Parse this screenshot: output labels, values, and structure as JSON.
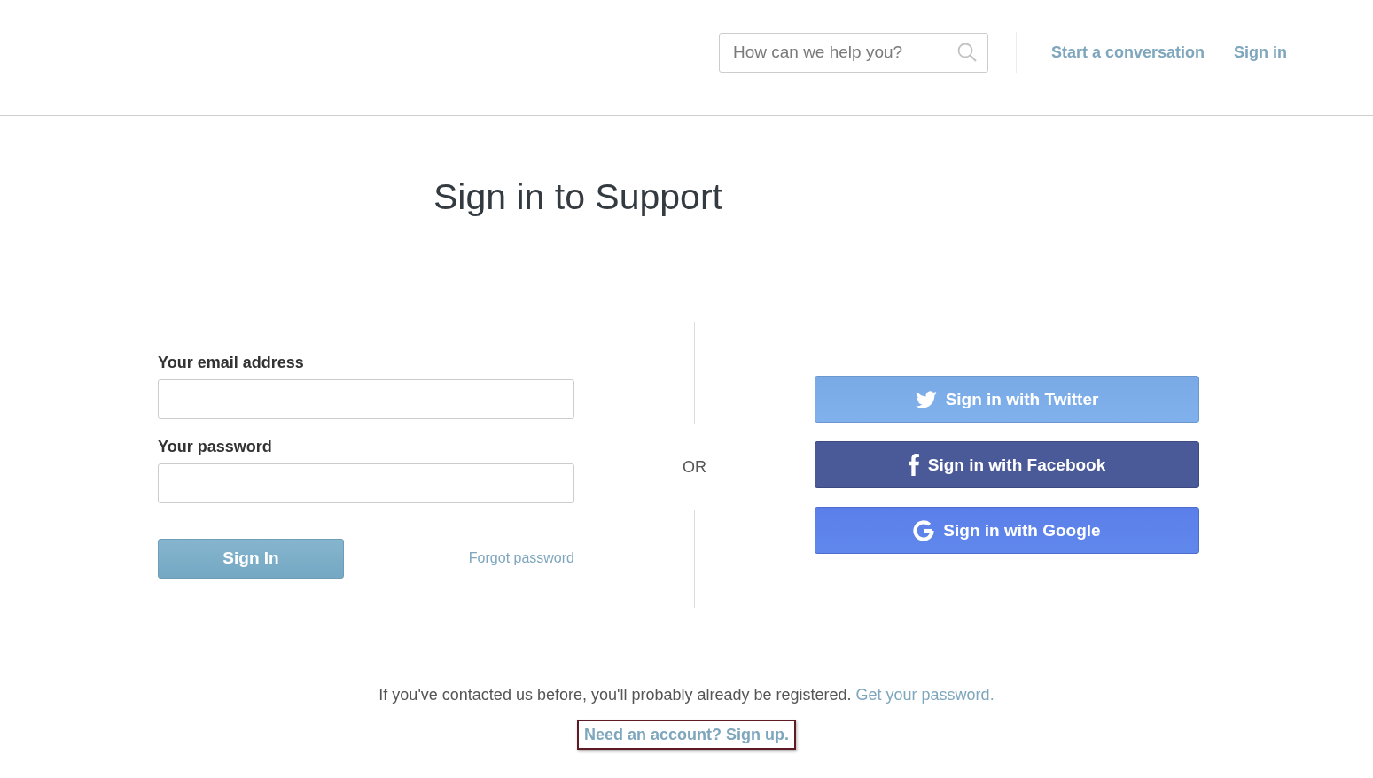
{
  "header": {
    "search": {
      "placeholder": "How can we help you?"
    },
    "nav_links": [
      "Start a conversation",
      "Sign in"
    ]
  },
  "title": "Sign in to Support",
  "form": {
    "fields": [
      {
        "label": "Your email address"
      },
      {
        "label": "Your password"
      }
    ],
    "submit_button": "Sign In",
    "forgot_link": "Forgot password"
  },
  "divider_text": "OR",
  "social_buttons": [
    {
      "kind": "twitter",
      "label": "Sign in with Twitter"
    },
    {
      "kind": "facebook",
      "label": "Sign in with Facebook"
    },
    {
      "kind": "google",
      "label": "Sign in with Google"
    }
  ],
  "footer": {
    "text": "If you've contacted us before, you'll probably already be registered.",
    "link": "Get your password.",
    "signup_link": {
      "label": "Need an account? Sign up.",
      "highlighted": true
    }
  }
}
